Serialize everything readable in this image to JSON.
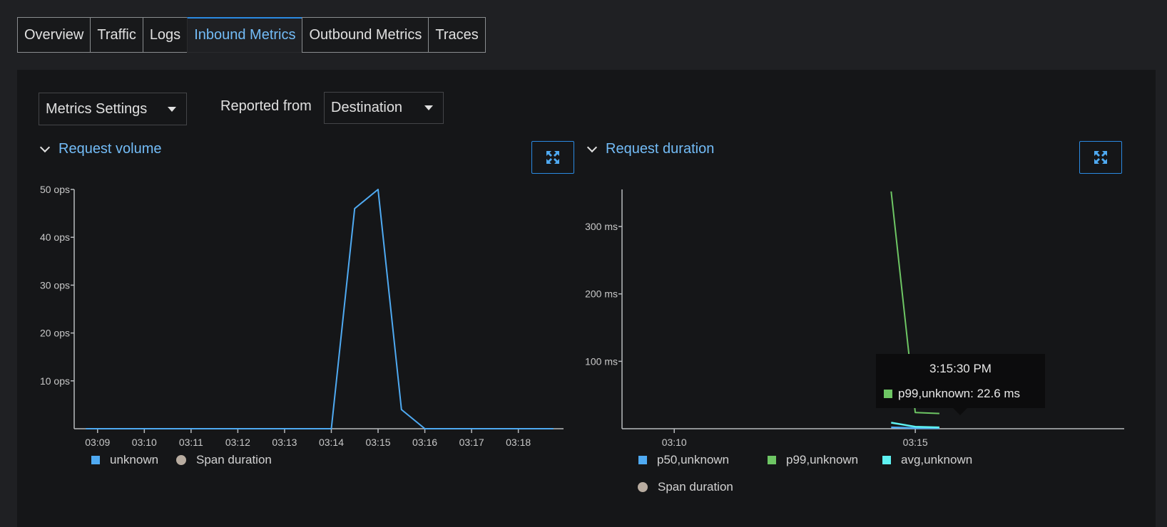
{
  "tabs": [
    {
      "label": "Overview",
      "active": false
    },
    {
      "label": "Traffic",
      "active": false
    },
    {
      "label": "Logs",
      "active": false
    },
    {
      "label": "Inbound Metrics",
      "active": true
    },
    {
      "label": "Outbound Metrics",
      "active": false
    },
    {
      "label": "Traces",
      "active": false
    }
  ],
  "toolbar": {
    "metrics_settings_label": "Metrics Settings",
    "reported_from_label": "Reported from",
    "reported_from_value": "Destination"
  },
  "colors": {
    "accent": "#73bcf7",
    "series_blue": "#4faaf2",
    "series_green": "#6ec664",
    "series_cyan": "#5ef2f2",
    "span_duration": "#b8aca0"
  },
  "icons": {
    "collapse": "chevron-down-icon",
    "expand": "expand-icon",
    "dropdown": "caret-down-icon"
  },
  "chart_data": [
    {
      "type": "line",
      "title": "Request volume",
      "xlabel": "",
      "ylabel": "",
      "x_ticks": [
        "03:09",
        "03:10",
        "03:11",
        "03:12",
        "03:13",
        "03:14",
        "03:15",
        "03:16",
        "03:17",
        "03:18"
      ],
      "y_ticks": [
        "10 ops",
        "20 ops",
        "30 ops",
        "40 ops",
        "50 ops"
      ],
      "ylim": [
        0,
        50
      ],
      "series": [
        {
          "name": "unknown",
          "color": "#4faaf2",
          "x": [
            "03:08:45",
            "03:14:00",
            "03:14:30",
            "03:15:00",
            "03:15:30",
            "03:16:00",
            "03:18:45"
          ],
          "values": [
            0,
            0,
            46,
            50,
            4,
            0,
            0
          ]
        }
      ],
      "legend": [
        {
          "label": "unknown",
          "marker": "square",
          "color": "#4faaf2"
        },
        {
          "label": "Span duration",
          "marker": "circle",
          "color": "#b8aca0"
        }
      ]
    },
    {
      "type": "line",
      "title": "Request duration",
      "xlabel": "",
      "ylabel": "",
      "x_ticks": [
        "03:10",
        "03:15"
      ],
      "y_ticks": [
        "100 ms",
        "200 ms",
        "300 ms"
      ],
      "ylim": [
        0,
        355
      ],
      "series": [
        {
          "name": "p50,unknown",
          "color": "#4faaf2",
          "x": [
            "03:14:30",
            "03:15:00",
            "03:15:30"
          ],
          "values": [
            2,
            1,
            1
          ]
        },
        {
          "name": "p99,unknown",
          "color": "#6ec664",
          "x": [
            "03:14:30",
            "03:15:00",
            "03:15:30"
          ],
          "values": [
            352,
            24,
            22.6
          ]
        },
        {
          "name": "avg,unknown",
          "color": "#5ef2f2",
          "x": [
            "03:14:30",
            "03:15:00",
            "03:15:30"
          ],
          "values": [
            9,
            3,
            2
          ]
        }
      ],
      "legend": [
        {
          "label": "p50,unknown",
          "marker": "square",
          "color": "#4faaf2"
        },
        {
          "label": "p99,unknown",
          "marker": "square",
          "color": "#6ec664"
        },
        {
          "label": "avg,unknown",
          "marker": "square",
          "color": "#5ef2f2"
        },
        {
          "label": "Span duration",
          "marker": "circle",
          "color": "#b8aca0"
        }
      ],
      "tooltip": {
        "time": "3:15:30 PM",
        "text": "p99,unknown: 22.6 ms",
        "color": "#6ec664"
      }
    }
  ]
}
